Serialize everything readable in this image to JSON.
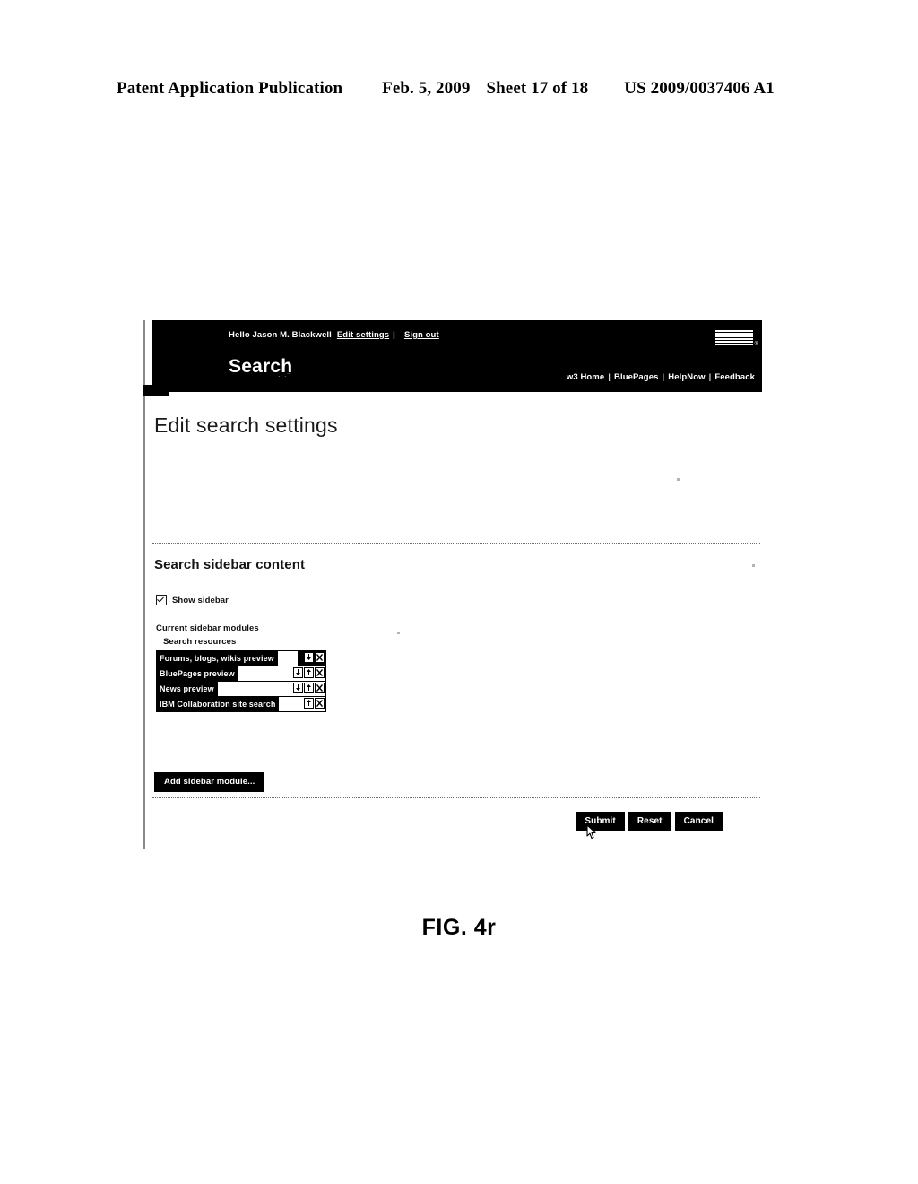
{
  "patent_header": {
    "publication": "Patent Application Publication",
    "date": "Feb. 5, 2009",
    "sheet": "Sheet 17 of 18",
    "number": "US 2009/0037406 A1"
  },
  "figure_caption": "FIG. 4r",
  "app": {
    "banner": {
      "greeting": "Hello Jason M. Blackwell",
      "edit_settings_link": "Edit settings",
      "separator": "|",
      "sign_out_link": "Sign out",
      "brand": "Search",
      "logo_alt": "IBM",
      "utility_nav": [
        "w3 Home",
        "BluePages",
        "HelpNow",
        "Feedback"
      ]
    },
    "page_title": "Edit search settings",
    "section": {
      "title": "Search sidebar content",
      "show_sidebar_checkbox": {
        "label": "Show sidebar",
        "checked": true
      },
      "modules_label": "Current sidebar modules",
      "modules_group_label": "Search resources",
      "modules": [
        {
          "name": "Forums, blogs, wikis preview",
          "controls": [
            "move-down",
            "remove"
          ]
        },
        {
          "name": "BluePages preview",
          "controls": [
            "move-down",
            "move-up",
            "remove"
          ]
        },
        {
          "name": "News preview",
          "controls": [
            "move-down",
            "move-up",
            "remove"
          ]
        },
        {
          "name": "IBM Collaboration site search",
          "controls": [
            "move-up",
            "remove"
          ]
        }
      ],
      "add_module_button": "Add sidebar module..."
    },
    "footer_buttons": {
      "submit": "Submit",
      "reset": "Reset",
      "cancel": "Cancel"
    }
  },
  "colors": {
    "banner_bg": "#000000",
    "banner_text": "#ffffff",
    "page_bg": "#ffffff",
    "body_text": "#111111",
    "divider": "#6b6b6b"
  }
}
